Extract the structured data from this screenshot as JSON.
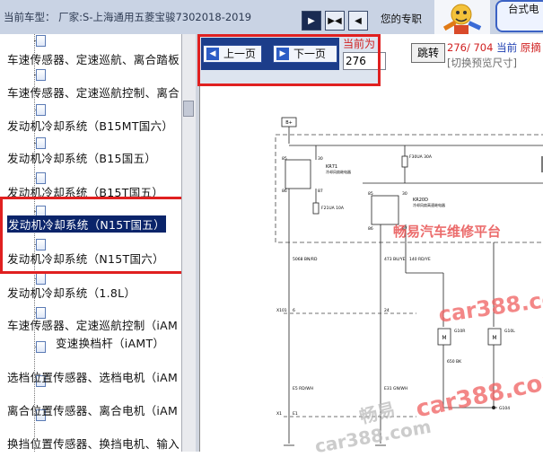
{
  "header": {
    "vehicle_label": "当前车型：  厂家:S-上海通用五菱宝骏7302018-2019",
    "nav_buttons": [
      "▶",
      "▶◀",
      "◀"
    ],
    "your_pro_text": "您的专职",
    "brand_text": "台式电"
  },
  "sidebar": {
    "items": [
      {
        "label": "车速传感器、定速巡航、离合踏板"
      },
      {
        "label": "车速传感器、定速巡航控制、离合"
      },
      {
        "label": "发动机冷却系统（B15MT国六）"
      },
      {
        "label": "发动机冷却系统（B15国五）"
      },
      {
        "label": "发动机冷却系统（B15T国五）"
      },
      {
        "label": "发动机冷却系统（N15T国五）"
      },
      {
        "label": "发动机冷却系统（N15T国六）"
      },
      {
        "label": "发动机冷却系统（1.8L）"
      },
      {
        "label": "车速传感器、定速巡航控制（iAM"
      },
      {
        "label": "变速换档杆（iAMT）"
      },
      {
        "label": "选档位置传感器、选档电机（iAM"
      },
      {
        "label": "离合位置传感器、离合电机（iAM"
      },
      {
        "label": "换挡位置传感器、换挡电机、输入"
      }
    ]
  },
  "pager": {
    "prev_label": "上一页",
    "next_label": "下一页",
    "current_label": "当前为",
    "current_page": "276",
    "jump_label": "跳转"
  },
  "page_info": {
    "current": "276",
    "total": "704",
    "current_text": "当前",
    "doc_text": "原摘",
    "preview_size": "[切换预览尺寸]"
  },
  "diagram": {
    "labels": {
      "top_box": "B+",
      "fuse1": "F30UA\n30A",
      "fuse2": "F21UA\n10A",
      "relay1": "KR71",
      "relay1_desc": "冷却风扇继电器",
      "relay2": "KR20D",
      "relay2_desc": "冷却风扇高速继电器",
      "wire1": "5068\nBN/RD",
      "wire2": "473\nBU/YE",
      "wire3": "140\nRD/YE",
      "connector": "X101",
      "pin6": "6",
      "pin24": "24",
      "wire_e5": "E5\nRD/WH",
      "wire_e31": "E31\nGN/WH",
      "wire_e54": "E54\nBK",
      "x1": "X1",
      "e1": "E1",
      "m1": "M",
      "m2": "M",
      "motor1": "G10R",
      "motor2": "G10L",
      "g104": "G104",
      "w650": "650\nBK",
      "n30_1": "30",
      "n85_1": "85",
      "n86_1": "86",
      "n87_1": "87",
      "n30_2": "30",
      "n85_2": "85",
      "n86_2": "86",
      "n87_2": "87"
    },
    "watermarks": [
      "畅易汽车维修平台",
      "car388.com",
      "car388.com",
      "畅易",
      "car388.com"
    ]
  },
  "colors": {
    "highlight_border": "#e02020",
    "selection_bg": "#0a246a",
    "pager_bg": "#1c3d8a",
    "watermark_red": "#e53a3a"
  }
}
